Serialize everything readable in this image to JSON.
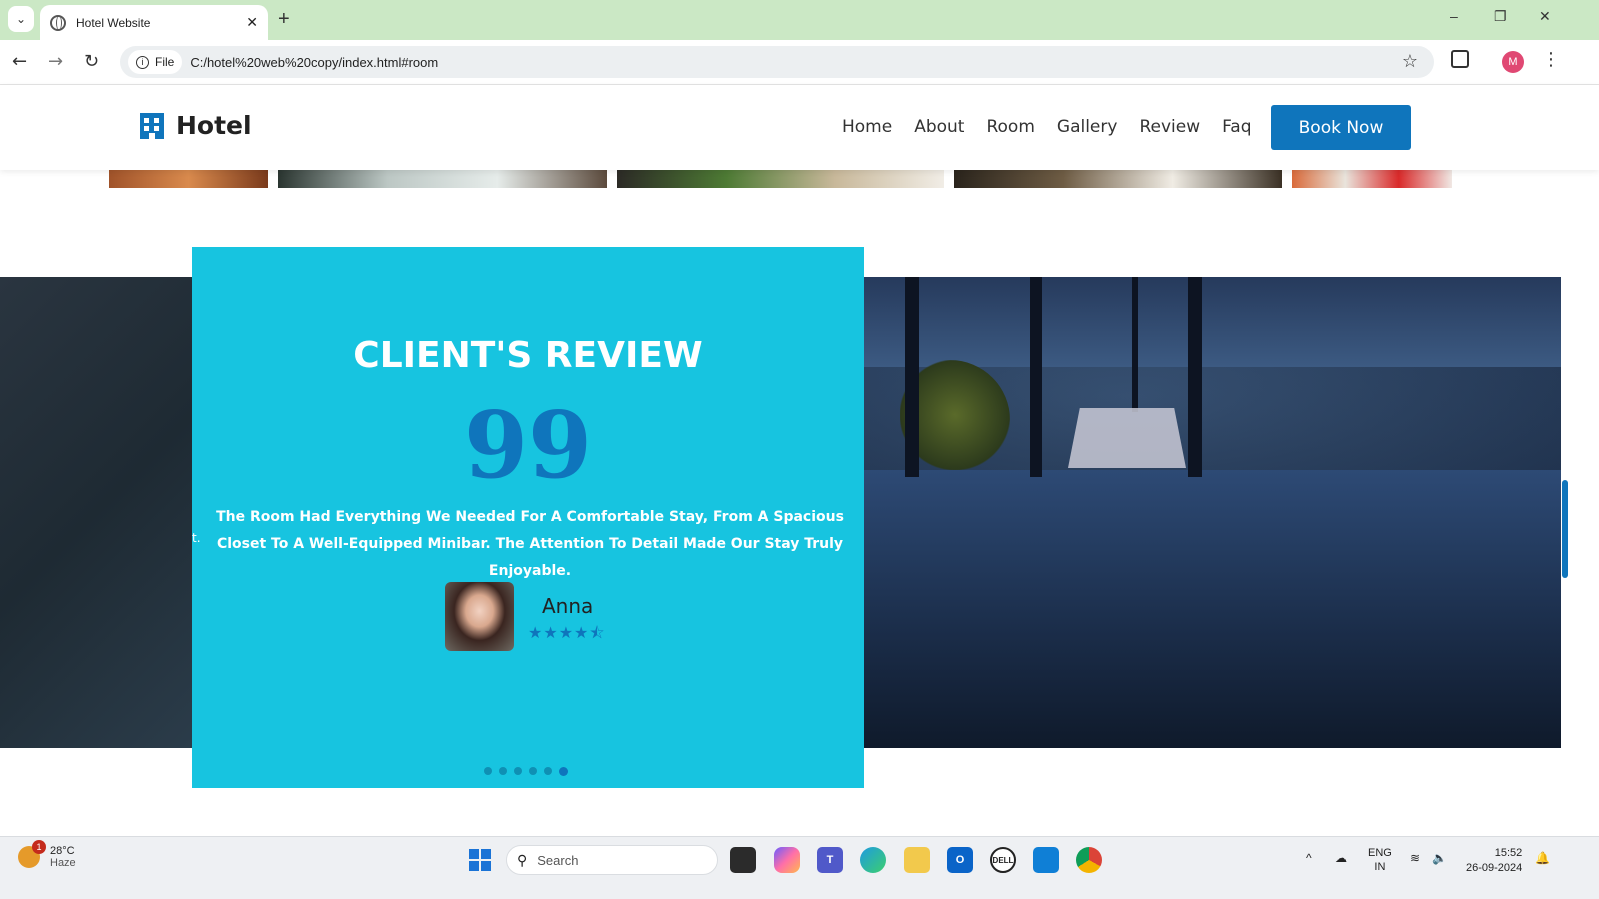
{
  "browser": {
    "tab_title": "Hotel Website",
    "new_tab": "+",
    "url_chip": "File",
    "url": "C:/hotel%20web%20copy/index.html#room",
    "profile_initial": "M",
    "win_min": "–",
    "win_restore": "❐",
    "win_close": "✕"
  },
  "site": {
    "logo_text": "Hotel",
    "nav": [
      "Home",
      "About",
      "Room",
      "Gallery",
      "Review",
      "Faq"
    ],
    "book_button": "Book Now"
  },
  "review": {
    "title": "CLIENT'S REVIEW",
    "quote_mark": "99",
    "text": "The Room Had Everything We Needed For A Comfortable Stay, From A Spacious Closet To A Well-Equipped Minibar. The Attention To Detail Made Our Stay Truly Enjoyable.",
    "stray_char": "t.",
    "reviewer_name": "Anna",
    "rating": 4.5,
    "stars_text": "★★★★⯪",
    "slides_total": 6,
    "active_slide": 6
  },
  "taskbar": {
    "weather_temp": "28°C",
    "weather_desc": "Haze",
    "weather_badge": "1",
    "search_placeholder": "Search",
    "lang_line1": "ENG",
    "lang_line2": "IN",
    "time": "15:52",
    "date": "26-09-2024",
    "tray_chevron": "^"
  },
  "colors": {
    "brand_blue": "#0f75bc",
    "review_card": "#17c4e0",
    "tabbar_bg": "#cbe8c5"
  }
}
